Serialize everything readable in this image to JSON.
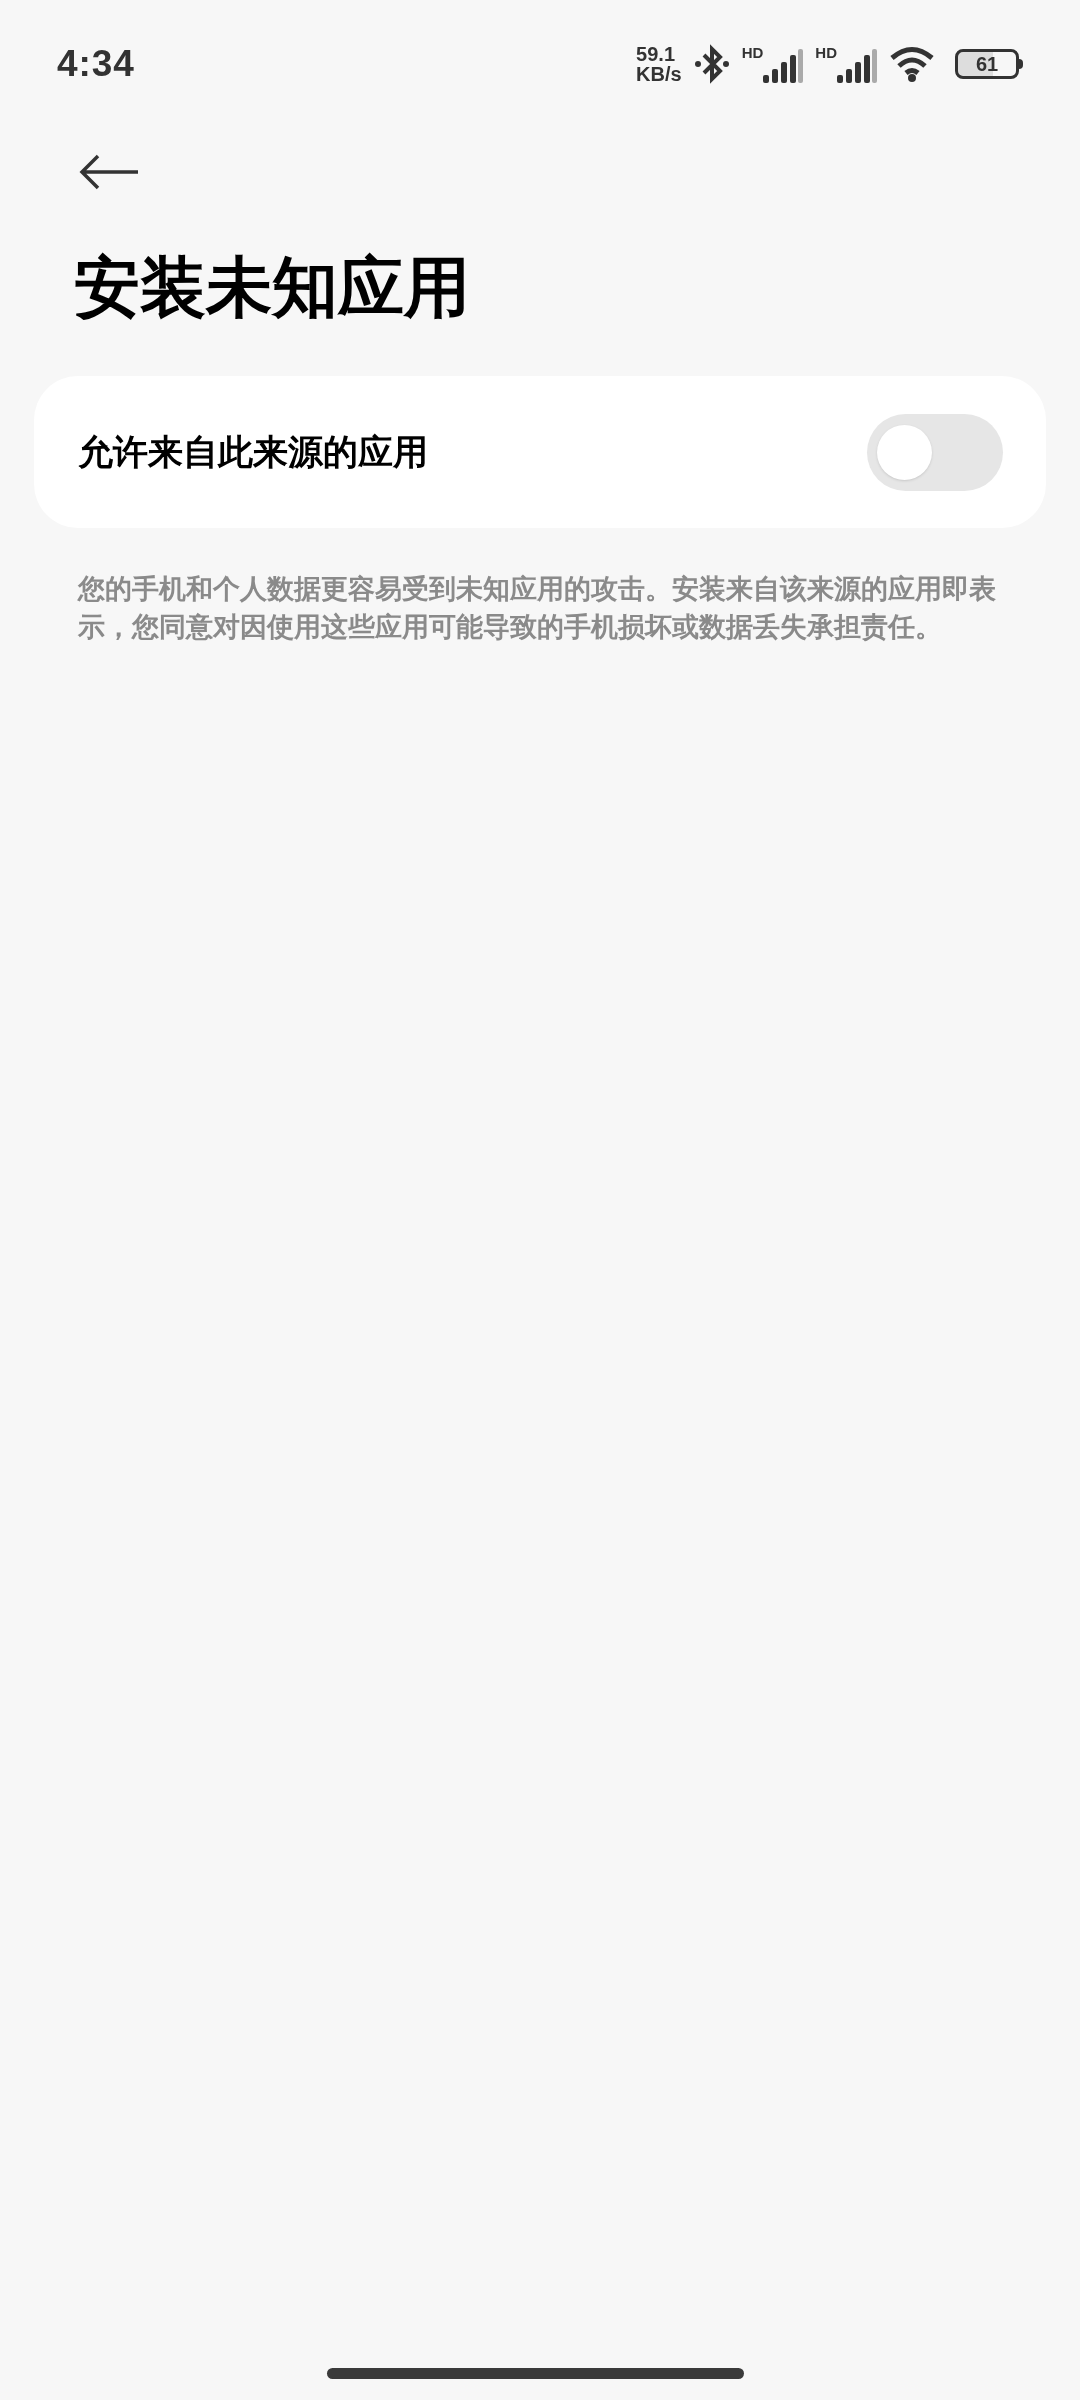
{
  "status_bar": {
    "time": "4:34",
    "net_speed_value": "59.1",
    "net_speed_unit": "KB/s",
    "sim_labels": [
      "HD",
      "HD"
    ],
    "battery": "61"
  },
  "header": {
    "title": "安装未知应用"
  },
  "setting": {
    "label": "允许来自此来源的应用",
    "checked": false
  },
  "description": "您的手机和个人数据更容易受到未知应用的攻击。安装来自该来源的应用即表示，您同意对因使用这些应用可能导致的手机损坏或数据丢失承担责任。"
}
